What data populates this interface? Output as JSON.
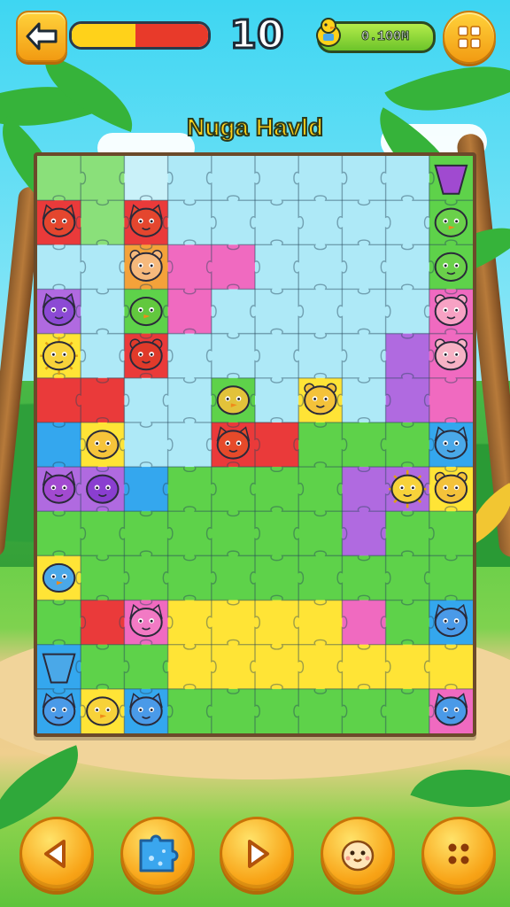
{
  "hud": {
    "back_icon": "back-arrow-icon",
    "progress_fraction": 0.47,
    "progress_red_start_fraction": 0.47,
    "score": "10",
    "coins_text": "0.100M",
    "coin_icon": "duck-coin-icon",
    "menu_icon": "grid-menu-icon"
  },
  "level_title": "Nuga Havld",
  "board": {
    "cols": 10,
    "rows": 13,
    "colors": {
      "R": "#ea3a3a",
      "B": "#34a7ee",
      "Y": "#ffe436",
      "G": "#5ed24a",
      "L": "#8ae07a",
      "P": "#f06ac0",
      "V": "#b06ae0",
      "C": "#aee9f7",
      "O": "#f4a23a",
      "W": "#c9f1f9"
    },
    "grid": [
      "LLWCCCCCCG",
      "RLRCCCCCCG",
      "CCOPPCCCCG",
      "VCGPCCCCCP",
      "YCRCCCCCVP",
      "RRCCGCYCVP",
      "BYCCRRGGGB",
      "VVBGGGGVVY",
      "GGGGGGGVGG",
      "YGGGGGGGGG",
      "GRPYYYYPGB",
      "BGGYYYYYYY",
      "BYBGGGGGGP"
    ],
    "critters": [
      {
        "col": 0,
        "row": 1,
        "kind": "fox",
        "color": "#e4462e"
      },
      {
        "col": 2,
        "row": 1,
        "kind": "fox",
        "color": "#e4462e"
      },
      {
        "col": 2,
        "row": 2,
        "kind": "bear",
        "color": "#f6b97c"
      },
      {
        "col": 0,
        "row": 3,
        "kind": "cat",
        "color": "#8c4ad4"
      },
      {
        "col": 2,
        "row": 3,
        "kind": "bird",
        "color": "#62c83e"
      },
      {
        "col": 0,
        "row": 4,
        "kind": "sun",
        "color": "#f7d23a"
      },
      {
        "col": 2,
        "row": 4,
        "kind": "bear",
        "color": "#e03a2a"
      },
      {
        "col": 4,
        "row": 5,
        "kind": "bird",
        "color": "#e2c23a"
      },
      {
        "col": 6,
        "row": 5,
        "kind": "bear",
        "color": "#f4c23a"
      },
      {
        "col": 1,
        "row": 6,
        "kind": "blob",
        "color": "#f6c43a"
      },
      {
        "col": 4,
        "row": 6,
        "kind": "fox",
        "color": "#e64a2a"
      },
      {
        "col": 0,
        "row": 7,
        "kind": "cat",
        "color": "#a24ad0"
      },
      {
        "col": 1,
        "row": 7,
        "kind": "blob",
        "color": "#8a3ed0"
      },
      {
        "col": 9,
        "row": 1,
        "kind": "bird",
        "color": "#6ad04a"
      },
      {
        "col": 9,
        "row": 2,
        "kind": "blob",
        "color": "#6ad04a"
      },
      {
        "col": 9,
        "row": 3,
        "kind": "bear",
        "color": "#f7a2c4"
      },
      {
        "col": 9,
        "row": 4,
        "kind": "bear",
        "color": "#f6b2c4"
      },
      {
        "col": 9,
        "row": 6,
        "kind": "cat",
        "color": "#4aa8e8"
      },
      {
        "col": 8,
        "row": 7,
        "kind": "sun",
        "color": "#f7d23a"
      },
      {
        "col": 9,
        "row": 7,
        "kind": "bear",
        "color": "#f4c23a"
      },
      {
        "col": 0,
        "row": 9,
        "kind": "bird",
        "color": "#4aa8e8"
      },
      {
        "col": 2,
        "row": 10,
        "kind": "cat",
        "color": "#f27ac4"
      },
      {
        "col": 9,
        "row": 10,
        "kind": "cat",
        "color": "#4a9ae8"
      },
      {
        "col": 0,
        "row": 11,
        "kind": "cup",
        "color": "#4aa8e8"
      },
      {
        "col": 0,
        "row": 12,
        "kind": "cat",
        "color": "#4a9ae8"
      },
      {
        "col": 1,
        "row": 12,
        "kind": "bird",
        "color": "#f7d23a"
      },
      {
        "col": 2,
        "row": 12,
        "kind": "cat",
        "color": "#4a9ae8"
      },
      {
        "col": 9,
        "row": 12,
        "kind": "cat",
        "color": "#4a9ae8"
      },
      {
        "col": 9,
        "row": 0,
        "kind": "cup",
        "color": "#a04ad0"
      }
    ]
  },
  "controls": [
    {
      "name": "prev-button",
      "icon": "triangle-left-icon"
    },
    {
      "name": "puzzle-piece-button",
      "icon": "blue-puzzle-piece-icon"
    },
    {
      "name": "next-button",
      "icon": "triangle-right-icon"
    },
    {
      "name": "hint-button",
      "icon": "chick-face-icon"
    },
    {
      "name": "more-button",
      "icon": "dots-icon"
    }
  ]
}
